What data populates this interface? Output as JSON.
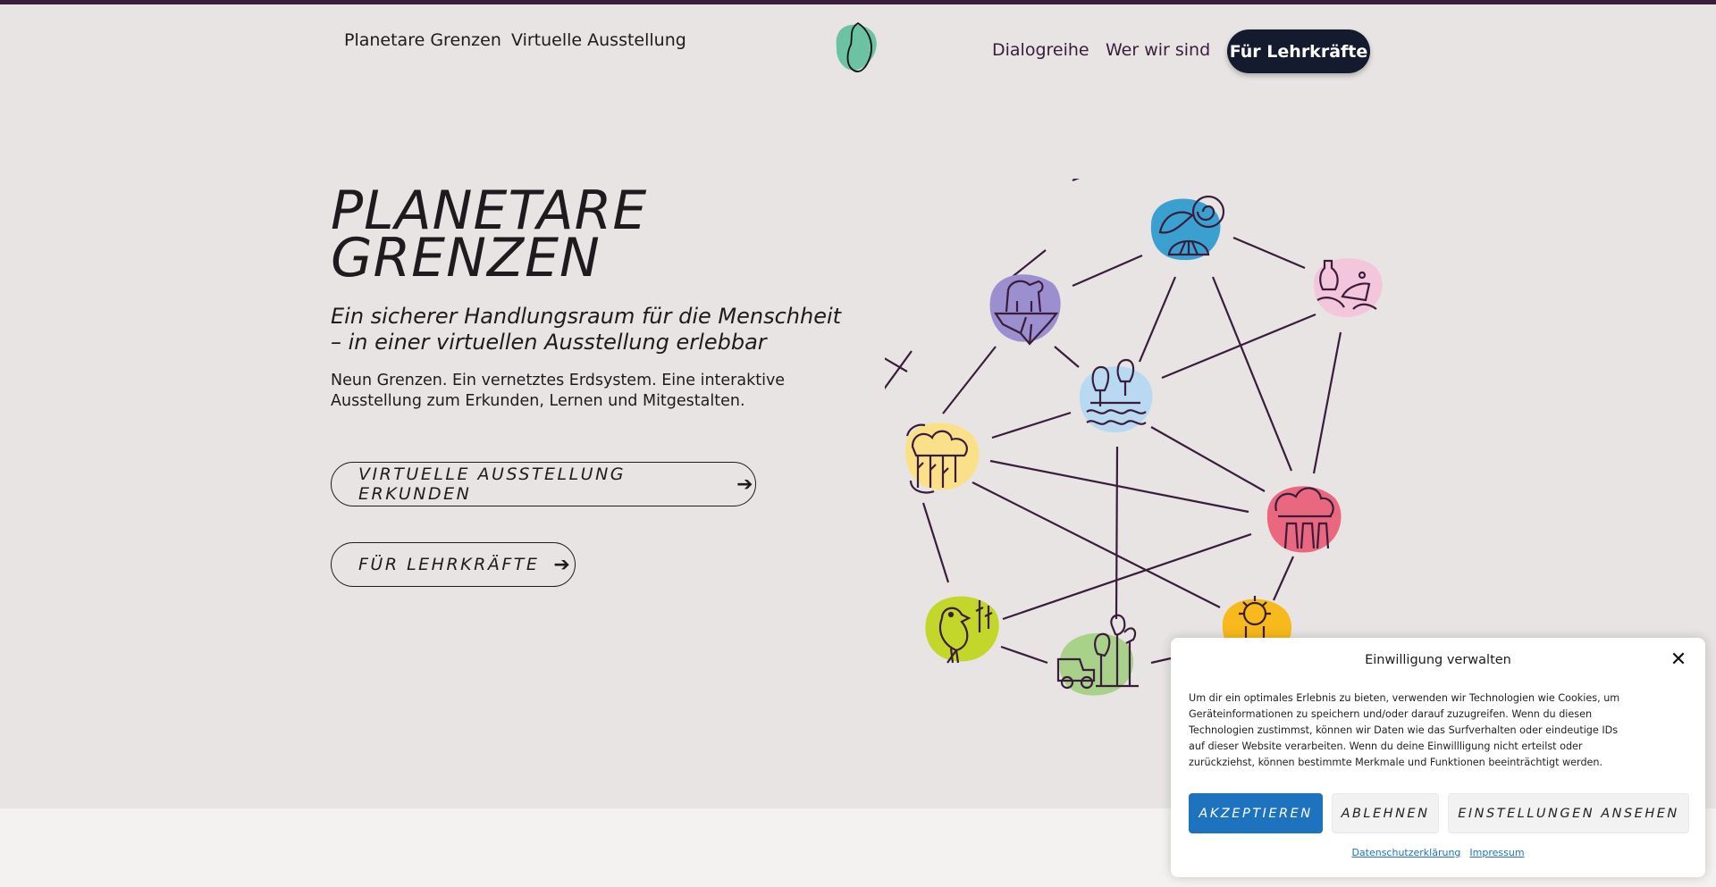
{
  "nav": {
    "left": [
      "Planetare Grenzen",
      "Virtuelle Ausstellung"
    ],
    "right": [
      "Dialogreihe",
      "Wer wir sind"
    ],
    "cta_label": "Für Lehrkräfte",
    "logo_icon": "leaf-blob-logo-icon"
  },
  "hero": {
    "title_line1": "PLANETARE",
    "title_line2": "GRENZEN",
    "subtitle": "Ein sicherer Handlungsraum für die Menschheit – in einer virtuellen Ausstellung erlebbar",
    "text": "Neun Grenzen. Ein vernetztes Erdsystem. Eine interaktive Ausstellung zum Erkunden, Lernen und Mitgestalten.",
    "cta_primary": "VIRTUELLE AUSSTELLUNG ERKUNDEN",
    "cta_secondary": "FÜR LEHRKRÄFTE",
    "arrow_icon": "arrow-right-icon"
  },
  "network": {
    "nodes": [
      {
        "icon": "ocean-shell-icon",
        "color": "#3aa0d0"
      },
      {
        "icon": "polar-bear-ice-icon",
        "color": "#9c8fcf"
      },
      {
        "icon": "plastic-pollution-icon",
        "color": "#f4c6dc"
      },
      {
        "icon": "freshwater-trees-icon",
        "color": "#b9d9f2"
      },
      {
        "icon": "forest-cycle-icon",
        "color": "#fbe08a"
      },
      {
        "icon": "factory-cloud-icon",
        "color": "#e9687f"
      },
      {
        "icon": "bird-biodiversity-icon",
        "color": "#c3d72b"
      },
      {
        "icon": "tractor-land-icon",
        "color": "#a8d18a"
      },
      {
        "icon": "ozone-sun-icon",
        "color": "#f7b91c"
      }
    ]
  },
  "cookie": {
    "title": "Einwilligung verwalten",
    "close_icon": "close-icon",
    "text": "Um dir ein optimales Erlebnis zu bieten, verwenden wir Technologien wie Cookies, um Geräteinformationen zu speichern und/oder darauf zuzugreifen. Wenn du diesen Technologien zustimmst, können wir Daten wie das Surfverhalten oder eindeutige IDs auf dieser Website verarbeiten. Wenn du deine Einwillligung nicht erteilst oder zurückziehst, können bestimmte Merkmale und Funktionen beeinträchtigt werden.",
    "accept": "AKZEPTIEREN",
    "deny": "ABLEHNEN",
    "prefs": "EINSTELLUNGEN ANSEHEN",
    "link_privacy": "Datenschutzerklärung",
    "link_imprint": "Impressum"
  }
}
